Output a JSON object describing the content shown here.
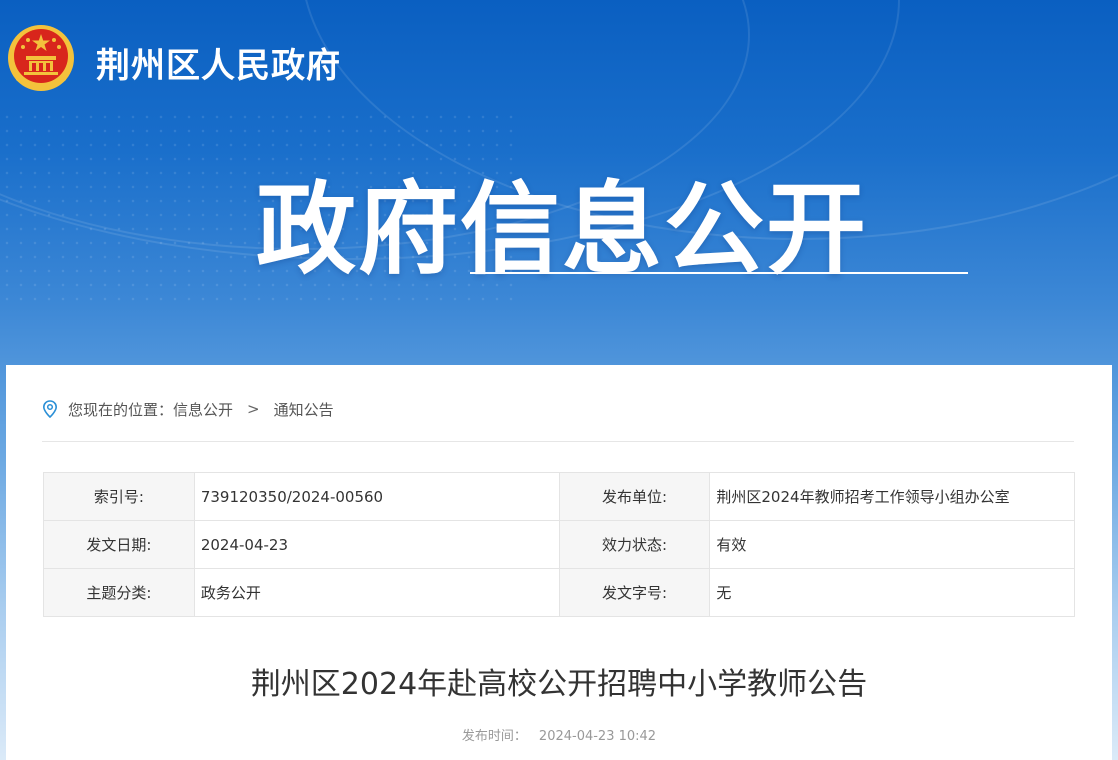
{
  "header": {
    "site_title": "荆州区人民政府",
    "hero_title": "政府信息公开"
  },
  "breadcrumb": {
    "prefix": "您现在的位置：",
    "items": [
      "信息公开",
      "通知公告"
    ],
    "separator": ">"
  },
  "meta": {
    "rows": [
      [
        {
          "label": "索引号:",
          "value": "739120350/2024-00560"
        },
        {
          "label": "发布单位:",
          "value": "荆州区2024年教师招考工作领导小组办公室"
        }
      ],
      [
        {
          "label": "发文日期:",
          "value": "2024-04-23"
        },
        {
          "label": "效力状态:",
          "value": "有效"
        }
      ],
      [
        {
          "label": "主题分类:",
          "value": "政务公开"
        },
        {
          "label": "发文字号:",
          "value": "无"
        }
      ]
    ]
  },
  "article": {
    "title": "荆州区2024年赴高校公开招聘中小学教师公告",
    "publish_label": "发布时间：",
    "publish_time": "2024-04-23 10:42"
  },
  "colors": {
    "banner_top": "#0a5fc1",
    "emblem_red": "#d8251c",
    "emblem_gold": "#f3c23c"
  }
}
